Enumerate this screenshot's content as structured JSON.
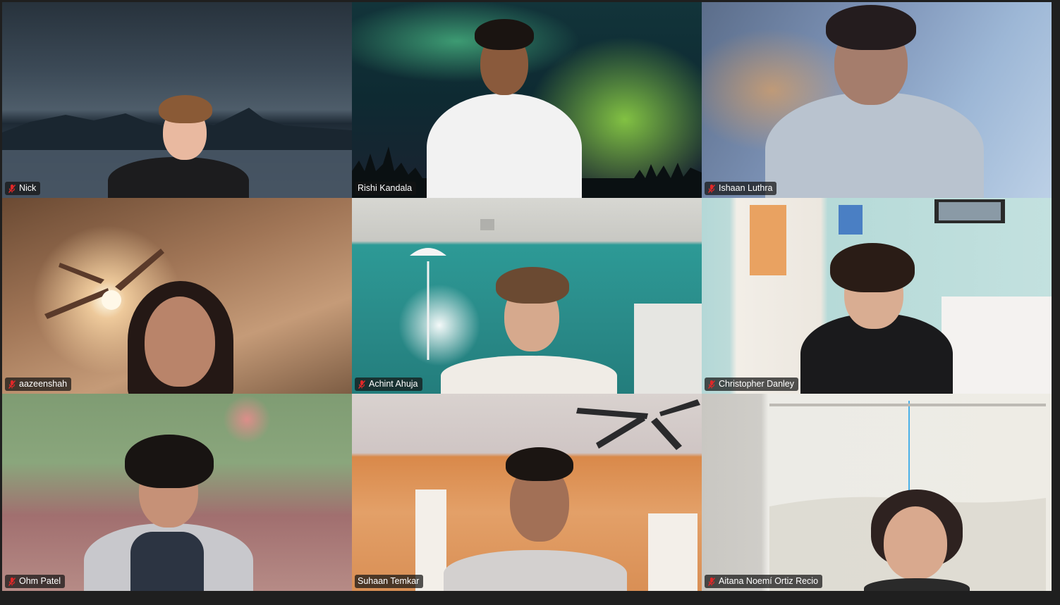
{
  "meeting": {
    "participants": [
      {
        "name": "Nick",
        "muted": true,
        "speaking": false
      },
      {
        "name": "Rishi Kandala",
        "muted": false,
        "speaking": false
      },
      {
        "name": "Ishaan Luthra",
        "muted": true,
        "speaking": false
      },
      {
        "name": "aazeenshah",
        "muted": true,
        "speaking": false
      },
      {
        "name": "Achint Ahuja",
        "muted": true,
        "speaking": false
      },
      {
        "name": "Christopher Danley",
        "muted": true,
        "speaking": false
      },
      {
        "name": "Ohm Patel",
        "muted": true,
        "speaking": false
      },
      {
        "name": "Suhaan Temkar",
        "muted": false,
        "speaking": true
      },
      {
        "name": "Aitana Noemí Ortiz Recio",
        "muted": true,
        "speaking": false
      }
    ]
  },
  "icons": {
    "muted_mic": "mic-muted-icon"
  },
  "colors": {
    "speaking_border": "#23d160",
    "muted_icon": "#e02828",
    "window_bg": "#1f1f1f"
  }
}
